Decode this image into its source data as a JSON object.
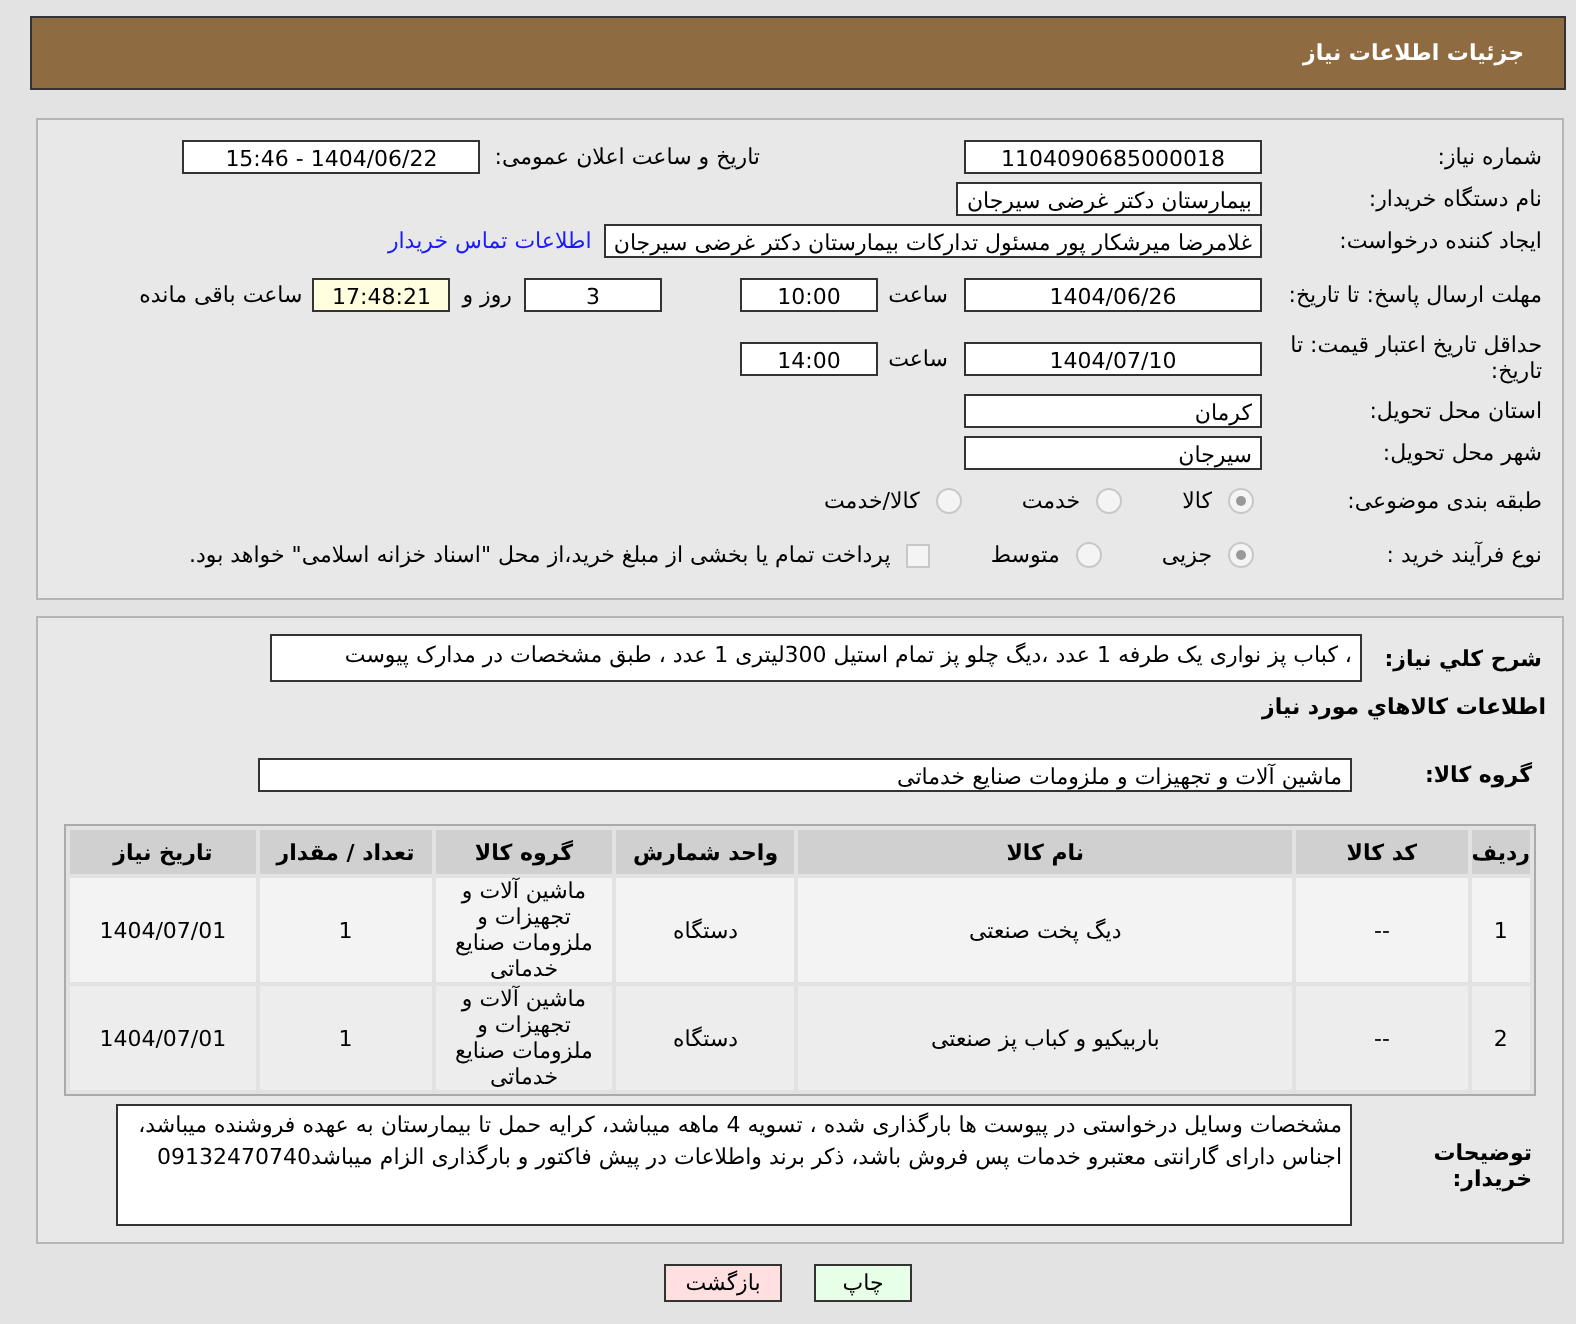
{
  "title": "جزئیات اطلاعات نیاز",
  "need_number": {
    "label": "شماره نیاز:",
    "value": "1104090685000018"
  },
  "announce": {
    "label": "تاریخ و ساعت اعلان عمومی:",
    "value": "1404/06/22 - 15:46"
  },
  "buyer_org": {
    "label": "نام دستگاه خریدار:",
    "value": "بیمارستان دکتر غرضی سیرجان"
  },
  "creator": {
    "label": "ایجاد کننده درخواست:",
    "value": "غلامرضا میرشکار پور مسئول تدارکات بیمارستان دکتر غرضی سیرجان",
    "link": "اطلاعات تماس خریدار"
  },
  "deadline": {
    "label": "مهلت ارسال پاسخ: تا تاریخ:",
    "date": "1404/06/26",
    "time_label": "ساعت",
    "time": "10:00",
    "days": "3",
    "days_label": "روز و",
    "remaining": "17:48:21",
    "remaining_label": "ساعت باقی مانده"
  },
  "validity": {
    "label": "حداقل تاریخ اعتبار قیمت: تا تاریخ:",
    "date": "1404/07/10",
    "time_label": "ساعت",
    "time": "14:00"
  },
  "province": {
    "label": "استان محل تحویل:",
    "value": "کرمان"
  },
  "city": {
    "label": "شهر محل تحویل:",
    "value": "سیرجان"
  },
  "category": {
    "label": "طبقه بندی موضوعی:",
    "options": [
      {
        "label": "کالا",
        "selected": true
      },
      {
        "label": "خدمت",
        "selected": false
      },
      {
        "label": "کالا/خدمت",
        "selected": false
      }
    ]
  },
  "purchase_type": {
    "label": "نوع فرآیند خرید :",
    "options": [
      {
        "label": "جزیی",
        "selected": true
      },
      {
        "label": "متوسط",
        "selected": false
      }
    ],
    "payment": {
      "label": "پرداخت تمام یا بخشی از مبلغ خرید،از محل \"اسناد خزانه اسلامی\" خواهد بود.",
      "checked": false
    }
  },
  "description": {
    "label": "شرح کلي نیاز:",
    "value": "، کباب پز نواری یک طرفه 1 عدد ،دیگ چلو پز تمام استیل 300لیتری 1 عدد ، طبق مشخصات در مدارک پیوست"
  },
  "goods_heading": "اطلاعات کالاهاي مورد نیاز",
  "goods_group": {
    "label": "گروه کالا:",
    "value": "ماشین آلات و تجهیزات و ملزومات صنایع خدماتی"
  },
  "table": {
    "columns": [
      "ردیف",
      "کد کالا",
      "نام کالا",
      "واحد شمارش",
      "گروه کالا",
      "تعداد / مقدار",
      "تاریخ نیاز"
    ],
    "rows": [
      [
        "1",
        "--",
        "دیگ پخت صنعتی",
        "دستگاه",
        "ماشین آلات و تجهیزات و ملزومات صنایع خدماتی",
        "1",
        "1404/07/01"
      ],
      [
        "2",
        "--",
        "باربیکیو و کباب پز صنعتی",
        "دستگاه",
        "ماشین آلات و تجهیزات و ملزومات صنایع خدماتی",
        "1",
        "1404/07/01"
      ]
    ]
  },
  "buyer_notes": {
    "label": "توضیحات خریدار:",
    "value": "مشخصات وسایل درخواستی در پیوست ها بارگذاری شده ، تسویه 4 ماهه میباشد، کرایه حمل تا بیمارستان به عهده فروشنده میباشد، اجناس دارای گارانتی معتبرو خدمات پس فروش باشد، ذکر برند واطلاعات در پیش فاکتور و بارگذاری الزام میباشد09132470740"
  },
  "buttons": [
    {
      "label": "چاپ",
      "kind": "print"
    },
    {
      "label": "بازگشت",
      "kind": "back"
    }
  ]
}
